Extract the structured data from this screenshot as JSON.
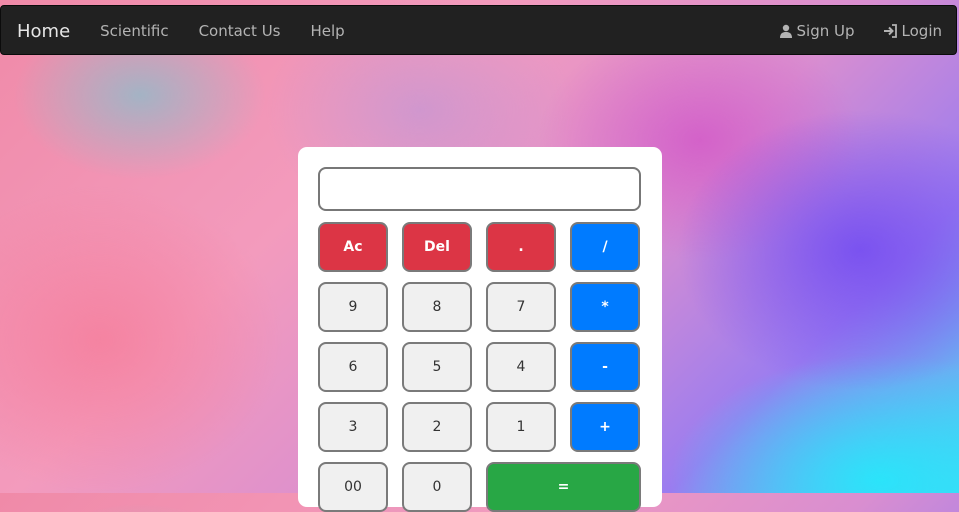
{
  "navbar": {
    "brand": "Home",
    "links": [
      "Scientific",
      "Contact Us",
      "Help"
    ],
    "signup": "Sign Up",
    "login": "Login"
  },
  "calculator": {
    "display_value": "",
    "rows": [
      [
        {
          "label": "Ac",
          "style": "red"
        },
        {
          "label": "Del",
          "style": "red"
        },
        {
          "label": ".",
          "style": "red"
        },
        {
          "label": "/",
          "style": "blue"
        }
      ],
      [
        {
          "label": "9",
          "style": "grey"
        },
        {
          "label": "8",
          "style": "grey"
        },
        {
          "label": "7",
          "style": "grey"
        },
        {
          "label": "*",
          "style": "blue"
        }
      ],
      [
        {
          "label": "6",
          "style": "grey"
        },
        {
          "label": "5",
          "style": "grey"
        },
        {
          "label": "4",
          "style": "grey"
        },
        {
          "label": "-",
          "style": "blue"
        }
      ],
      [
        {
          "label": "3",
          "style": "grey"
        },
        {
          "label": "2",
          "style": "grey"
        },
        {
          "label": "1",
          "style": "grey"
        },
        {
          "label": "+",
          "style": "blue"
        }
      ],
      [
        {
          "label": "00",
          "style": "grey"
        },
        {
          "label": "0",
          "style": "grey"
        },
        {
          "label": "=",
          "style": "green"
        }
      ]
    ]
  },
  "colors": {
    "navbar_bg": "#212121",
    "red": "#dc3545",
    "blue": "#007bff",
    "green": "#28a745",
    "grey": "#f0f0f0"
  }
}
